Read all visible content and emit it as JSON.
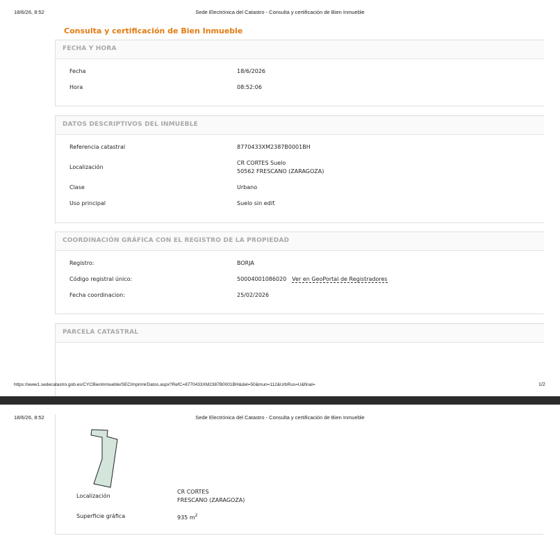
{
  "print_header": {
    "date": "18/6/26, 8:52",
    "title": "Sede Electrónica del Catastro - Consulta y certificación de Bien Inmueble"
  },
  "print_footer": {
    "url": "https://www1.sedecatastro.gob.es/CYCBienInmueble/SECImprimirDatos.aspx?RefC=8770433XM2387B0001BH&del=50&mun=112&UrbRus=U&final=",
    "page": "1/2"
  },
  "document": {
    "title": "Consulta y certificación de Bien Inmueble"
  },
  "fecha_hora": {
    "heading": "FECHA Y HORA",
    "fecha_label": "Fecha",
    "fecha_value": "18/6/2026",
    "hora_label": "Hora",
    "hora_value": "08:52:06"
  },
  "datos": {
    "heading": "DATOS DESCRIPTIVOS DEL INMUEBLE",
    "ref_label": "Referencia catastral",
    "ref_value": "8770433XM2387B0001BH",
    "loc_label": "Localización",
    "loc_line1": "CR CORTES Suelo",
    "loc_line2": "50562 FRESCANO (ZARAGOZA)",
    "clase_label": "Clase",
    "clase_value": "Urbano",
    "uso_label": "Uso principal",
    "uso_value": "Suelo sin edif."
  },
  "coordinacion": {
    "heading": "COORDINACIÓN GRÁFICA CON EL REGISTRO DE LA PROPIEDAD",
    "registro_label": "Registro:",
    "registro_value": "BORJA",
    "codigo_label": "Código registral único:",
    "codigo_value": "50004001086020",
    "geoportal_link": "Ver en GeoPortal de Registradores",
    "fecha_label": "Fecha coordinacion:",
    "fecha_value": "25/02/2026"
  },
  "parcela": {
    "heading": "PARCELA CATASTRAL",
    "loc_label": "Localización",
    "loc_line1": "CR CORTES",
    "loc_line2": "FRESCANO (ZARAGOZA)",
    "sup_label": "Superficie gráfica",
    "sup_value": "935 m",
    "sup_exp": "2"
  },
  "colors": {
    "accent": "#e47b12",
    "parcel_fill": "#d4e6dc",
    "section_heading": "#a8a8a8"
  }
}
